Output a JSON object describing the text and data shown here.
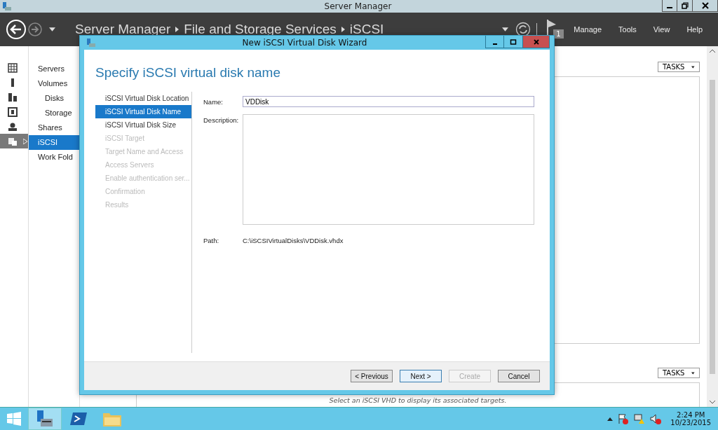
{
  "window": {
    "title": "Server Manager"
  },
  "header": {
    "breadcrumb": [
      "Server Manager",
      "File and Storage Services",
      "iSCSI"
    ],
    "notification_count": "1",
    "menu": [
      "Manage",
      "Tools",
      "View",
      "Help"
    ]
  },
  "rail": [
    {
      "selected": false
    },
    {
      "selected": false
    },
    {
      "selected": false
    },
    {
      "selected": false
    },
    {
      "selected": false
    },
    {
      "selected": true
    }
  ],
  "nav": [
    {
      "label": "Servers",
      "selected": false
    },
    {
      "label": "Volumes",
      "selected": false,
      "children": [
        {
          "label": "Disks",
          "selected": false
        },
        {
          "label": "Storage",
          "selected": false
        }
      ]
    },
    {
      "label": "Shares",
      "selected": false
    },
    {
      "label": "iSCSI",
      "selected": true
    },
    {
      "label": "Work Fold",
      "selected": false
    }
  ],
  "main": {
    "tasks_buttons": [
      "TASKS",
      "TASKS"
    ],
    "empty_message": "Select an iSCSI VHD to display its associated targets."
  },
  "dialog": {
    "title": "New iSCSI Virtual Disk Wizard",
    "heading": "Specify iSCSI virtual disk name",
    "steps": [
      {
        "label": "iSCSI Virtual Disk Location",
        "selected": false,
        "disabled": false
      },
      {
        "label": "iSCSI Virtual Disk Name",
        "selected": true,
        "disabled": false
      },
      {
        "label": "iSCSI Virtual Disk Size",
        "selected": false,
        "disabled": false
      },
      {
        "label": "iSCSI Target",
        "selected": false,
        "disabled": true
      },
      {
        "label": "Target Name and Access",
        "selected": false,
        "disabled": true
      },
      {
        "label": "Access Servers",
        "selected": false,
        "disabled": true
      },
      {
        "label": "Enable authentication ser...",
        "selected": false,
        "disabled": true
      },
      {
        "label": "Confirmation",
        "selected": false,
        "disabled": true
      },
      {
        "label": "Results",
        "selected": false,
        "disabled": true
      }
    ],
    "name_label": "Name:",
    "name_value": "VDDisk",
    "description_label": "Description:",
    "path_label": "Path:",
    "path_value": "C:\\iSCSIVirtualDisks\\VDDisk.vhdx",
    "buttons": [
      {
        "label": "< Previous",
        "disabled": false,
        "default": false
      },
      {
        "label": "Next >",
        "disabled": false,
        "default": true
      },
      {
        "label": "Create",
        "disabled": true,
        "default": false
      },
      {
        "label": "Cancel",
        "disabled": false,
        "default": false
      }
    ]
  },
  "taskbar": {
    "time": "2:24 PM",
    "date": "10/23/2015"
  }
}
